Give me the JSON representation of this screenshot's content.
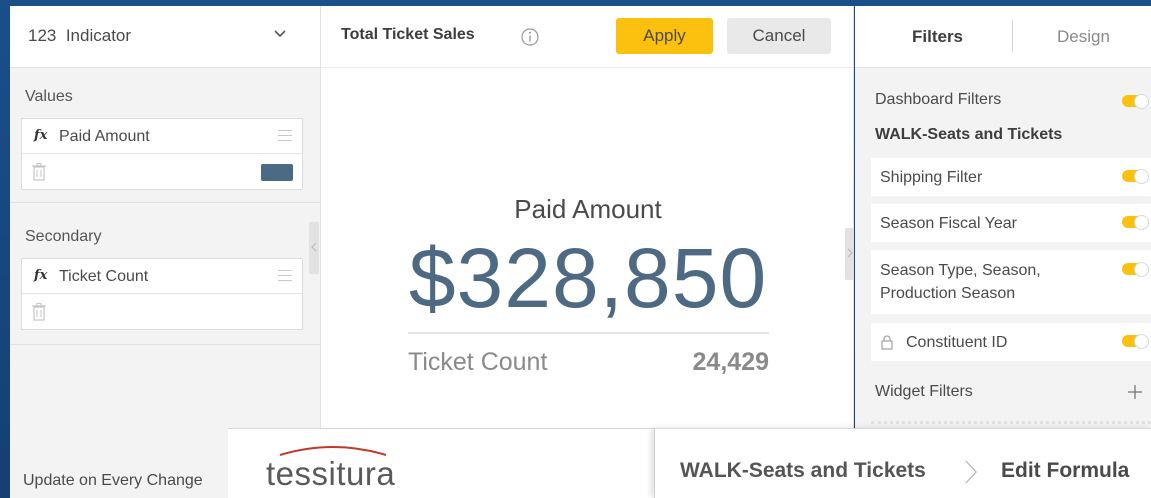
{
  "left_panel": {
    "widget_type_icon": "123",
    "widget_type_label": "Indicator",
    "values_label": "Values",
    "values_field": {
      "fx": "fx",
      "name": "Paid Amount",
      "swatch_color": "#4b6a83"
    },
    "secondary_label": "Secondary",
    "secondary_field": {
      "fx": "fx",
      "name": "Ticket Count"
    },
    "update_label": "Update on Every Change",
    "icons": [
      "chevron-down-icon",
      "fx-icon",
      "drag-handle-icon",
      "trash-icon",
      "collapse-arrow-icon"
    ]
  },
  "header": {
    "title": "Total Ticket Sales",
    "apply_label": "Apply",
    "cancel_label": "Cancel",
    "accent_color": "#fcc10e",
    "icons": [
      "info-icon"
    ]
  },
  "indicator": {
    "primary_label": "Paid Amount",
    "primary_value": "$328,850",
    "primary_color": "#4d6a82",
    "secondary_label": "Ticket Count",
    "secondary_value": "24,429"
  },
  "right_panel": {
    "tabs": [
      {
        "label": "Filters",
        "active": true
      },
      {
        "label": "Design",
        "active": false
      }
    ],
    "dashboard_filters_label": "Dashboard Filters",
    "dashboard_filters_on": true,
    "datasource_label": "WALK-Seats and Tickets",
    "filters": [
      {
        "label": "Shipping Filter",
        "on": true,
        "locked": false
      },
      {
        "label": "Season Fiscal Year",
        "on": true,
        "locked": false
      },
      {
        "label": "Season Type, Season, Production Season",
        "on": true,
        "locked": false
      },
      {
        "label": "Constituent ID",
        "on": true,
        "locked": true
      }
    ],
    "widget_filters_label": "Widget Filters",
    "icons": [
      "toggle-icon",
      "lock-icon",
      "plus-icon"
    ]
  },
  "branding": {
    "logo_text": "tessitura",
    "logo_arc_color": "#c0392b"
  },
  "breadcrumb": {
    "items": [
      "WALK-Seats and Tickets",
      "Edit Formula"
    ],
    "icons": [
      "chevron-right-icon"
    ]
  }
}
